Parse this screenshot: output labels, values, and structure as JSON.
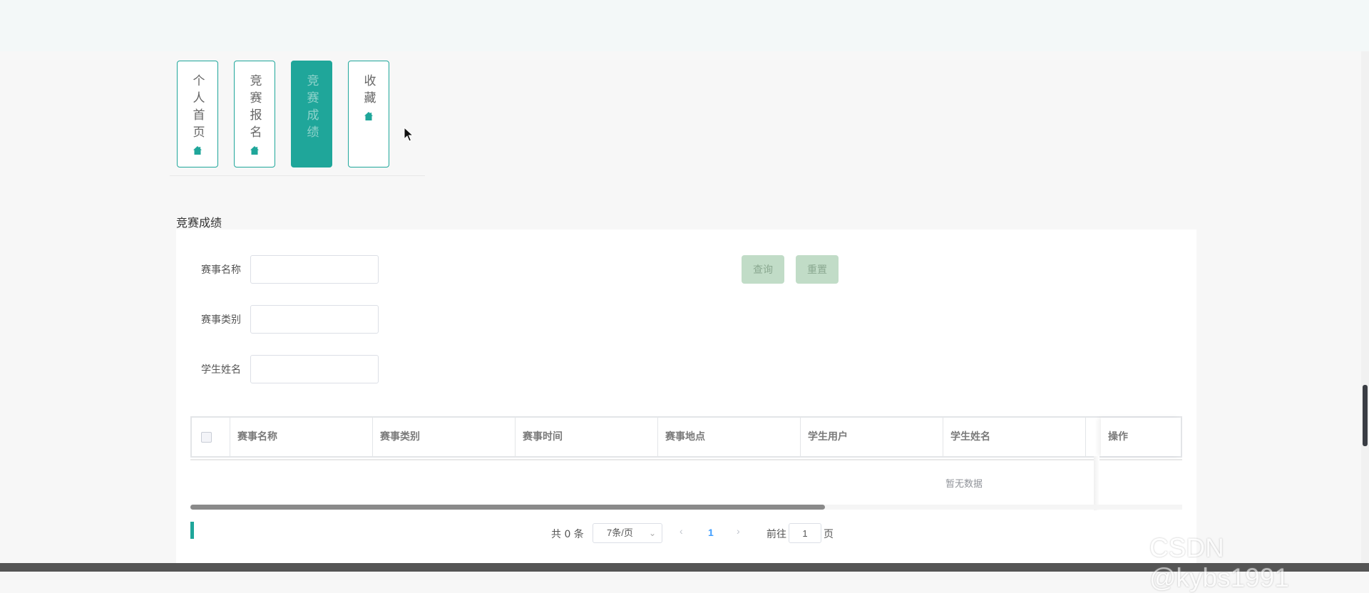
{
  "nav": {
    "items": [
      {
        "label": "个人首页",
        "icon": "home-icon",
        "active": false
      },
      {
        "label": "竞赛报名",
        "icon": "home-icon",
        "active": false
      },
      {
        "label": "竞赛成绩",
        "icon": "home-icon",
        "active": true
      },
      {
        "label": "收藏",
        "icon": "home-icon",
        "active": false
      }
    ]
  },
  "page": {
    "title": "竞赛成绩"
  },
  "search": {
    "fields": [
      {
        "label": "赛事名称",
        "value": ""
      },
      {
        "label": "赛事类别",
        "value": ""
      },
      {
        "label": "学生姓名",
        "value": ""
      }
    ],
    "query_label": "查询",
    "reset_label": "重置"
  },
  "table": {
    "columns": [
      "赛事名称",
      "赛事类别",
      "赛事时间",
      "赛事地点",
      "学生用户",
      "学生姓名",
      "操作"
    ],
    "empty_text": "暂无数据"
  },
  "pagination": {
    "total_text": "共 0 条",
    "page_size": "7条/页",
    "current_page": "1",
    "goto_prefix": "前往",
    "goto_value": "1",
    "goto_suffix": "页"
  },
  "watermark": "CSDN @kybs1991",
  "colors": {
    "accent": "#1fa69a",
    "button_disabled": "#c1dcc7",
    "link": "#409eff"
  }
}
